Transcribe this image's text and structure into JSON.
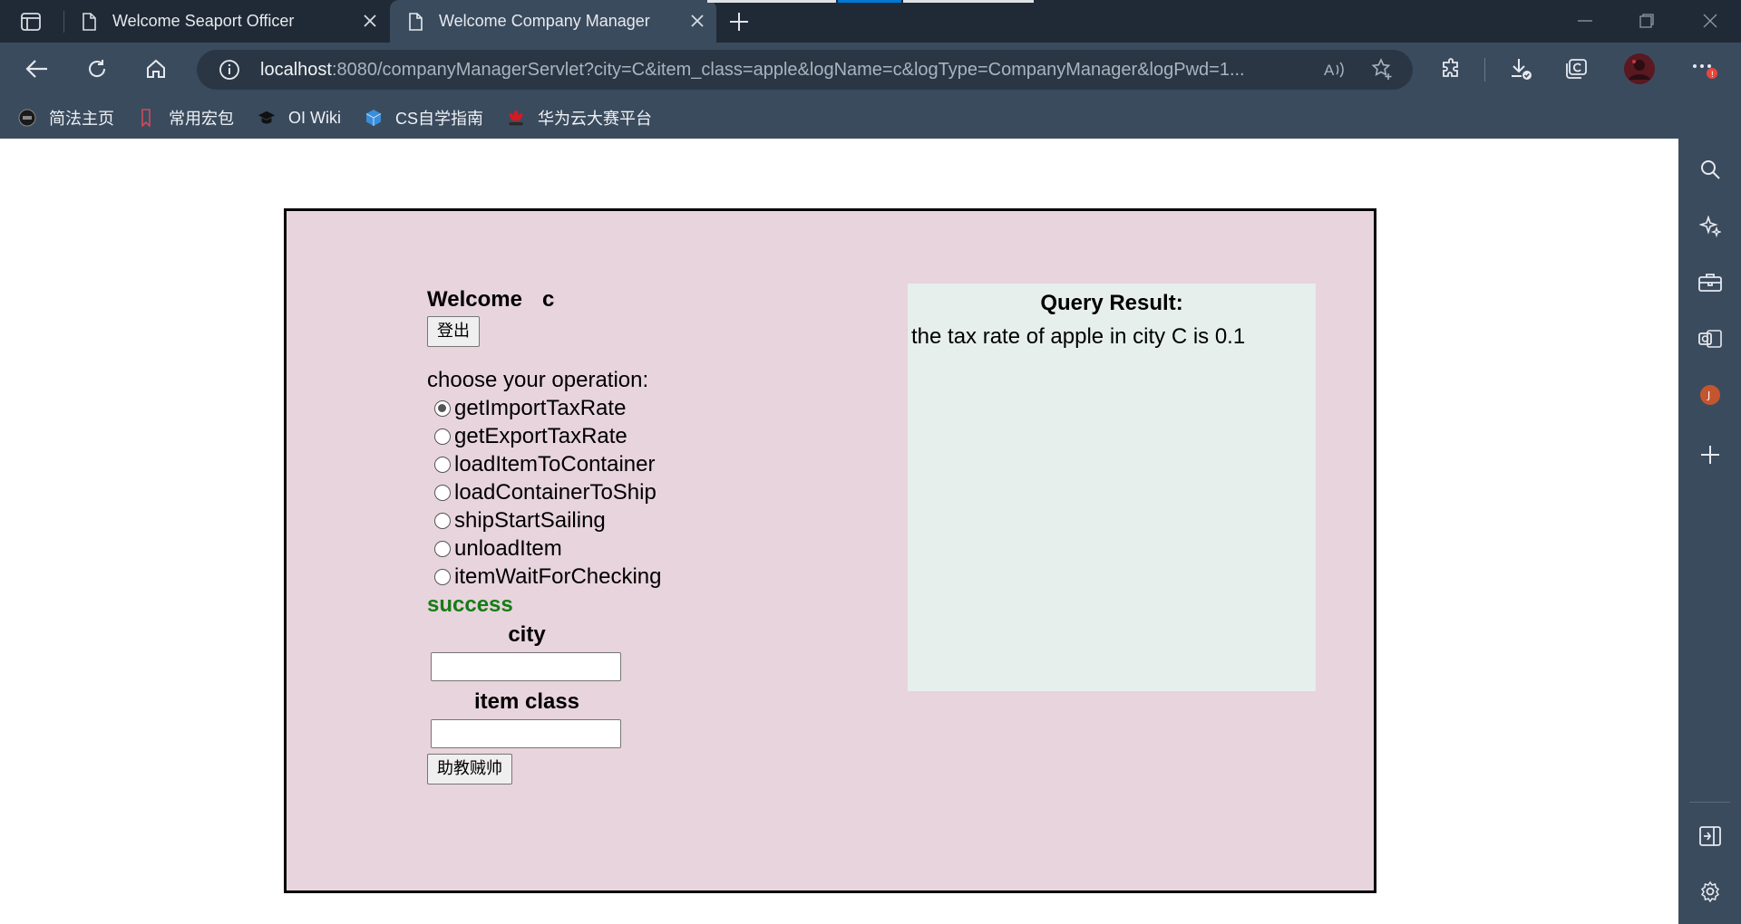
{
  "browser": {
    "tabs": [
      {
        "title": "Welcome Seaport Officer",
        "active": false
      },
      {
        "title": "Welcome Company Manager",
        "active": true
      }
    ],
    "address": {
      "host": "localhost",
      "rest": ":8080/companyManagerServlet?city=C&item_class=apple&logName=c&logType=CompanyManager&logPwd=1..."
    },
    "bookmarks": [
      {
        "label": "简法主页",
        "icon": "circle-logo-icon"
      },
      {
        "label": "常用宏包",
        "icon": "bookmark-red-icon"
      },
      {
        "label": "OI Wiki",
        "icon": "graduation-cap-icon"
      },
      {
        "label": "CS自学指南",
        "icon": "cube-icon"
      },
      {
        "label": "华为云大赛平台",
        "icon": "huawei-logo-icon"
      }
    ],
    "profile_badge": "J",
    "colors": {
      "chrome_dark": "#202a36",
      "chrome": "#3b4b5e",
      "accent": "#0078d4"
    }
  },
  "page": {
    "welcome_label": "Welcome",
    "username": "c",
    "logout_label": "登出",
    "operation_prompt": "choose your operation:",
    "operations": [
      {
        "label": "getImportTaxRate",
        "checked": true
      },
      {
        "label": "getExportTaxRate",
        "checked": false
      },
      {
        "label": "loadItemToContainer",
        "checked": false
      },
      {
        "label": "loadContainerToShip",
        "checked": false
      },
      {
        "label": "shipStartSailing",
        "checked": false
      },
      {
        "label": "unloadItem",
        "checked": false
      },
      {
        "label": "itemWaitForChecking",
        "checked": false
      }
    ],
    "status": "success",
    "city_label": "city",
    "city_value": "",
    "item_class_label": "item class",
    "item_class_value": "",
    "submit_label": "助教贼帅",
    "result_title": "Query Result:",
    "result_text": "the tax rate of apple in city C is 0.1",
    "colors": {
      "panel_bg": "#e8d4dc",
      "result_bg": "#e6efec",
      "status": "#147d14"
    }
  }
}
